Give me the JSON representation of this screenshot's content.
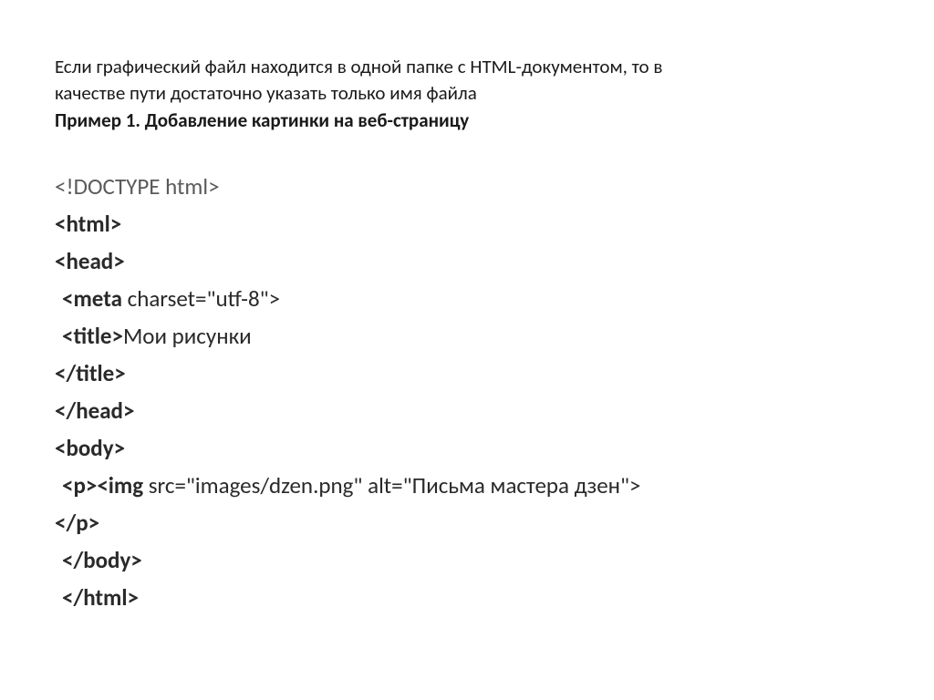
{
  "intro": {
    "line1": "Если графический файл находится в одной папке с HTML-документом, то в",
    "line2": "качестве пути достаточно указать только имя файла"
  },
  "example_title": "Пример 1. Добавление картинки на веб-страницу",
  "code": {
    "doctype": "<!DOCTYPE html>",
    "html_open": "<html>",
    "head_open": "<head>",
    "meta_tag": "<meta",
    "meta_attrs": " charset=\"utf-8\">",
    "title_open": "<title>",
    "title_text": "Мои рисунки",
    "title_close": "</title>",
    "head_close": "</head>",
    "body_open": "<body>",
    "p_open": "<p>",
    "img_tag": "<img",
    "img_attrs": " src=\"images/dzen.png\"  alt=\"Письма мастера дзен\">",
    "p_close": "</p>",
    "body_close": "</body>",
    "html_close": "</html>"
  }
}
